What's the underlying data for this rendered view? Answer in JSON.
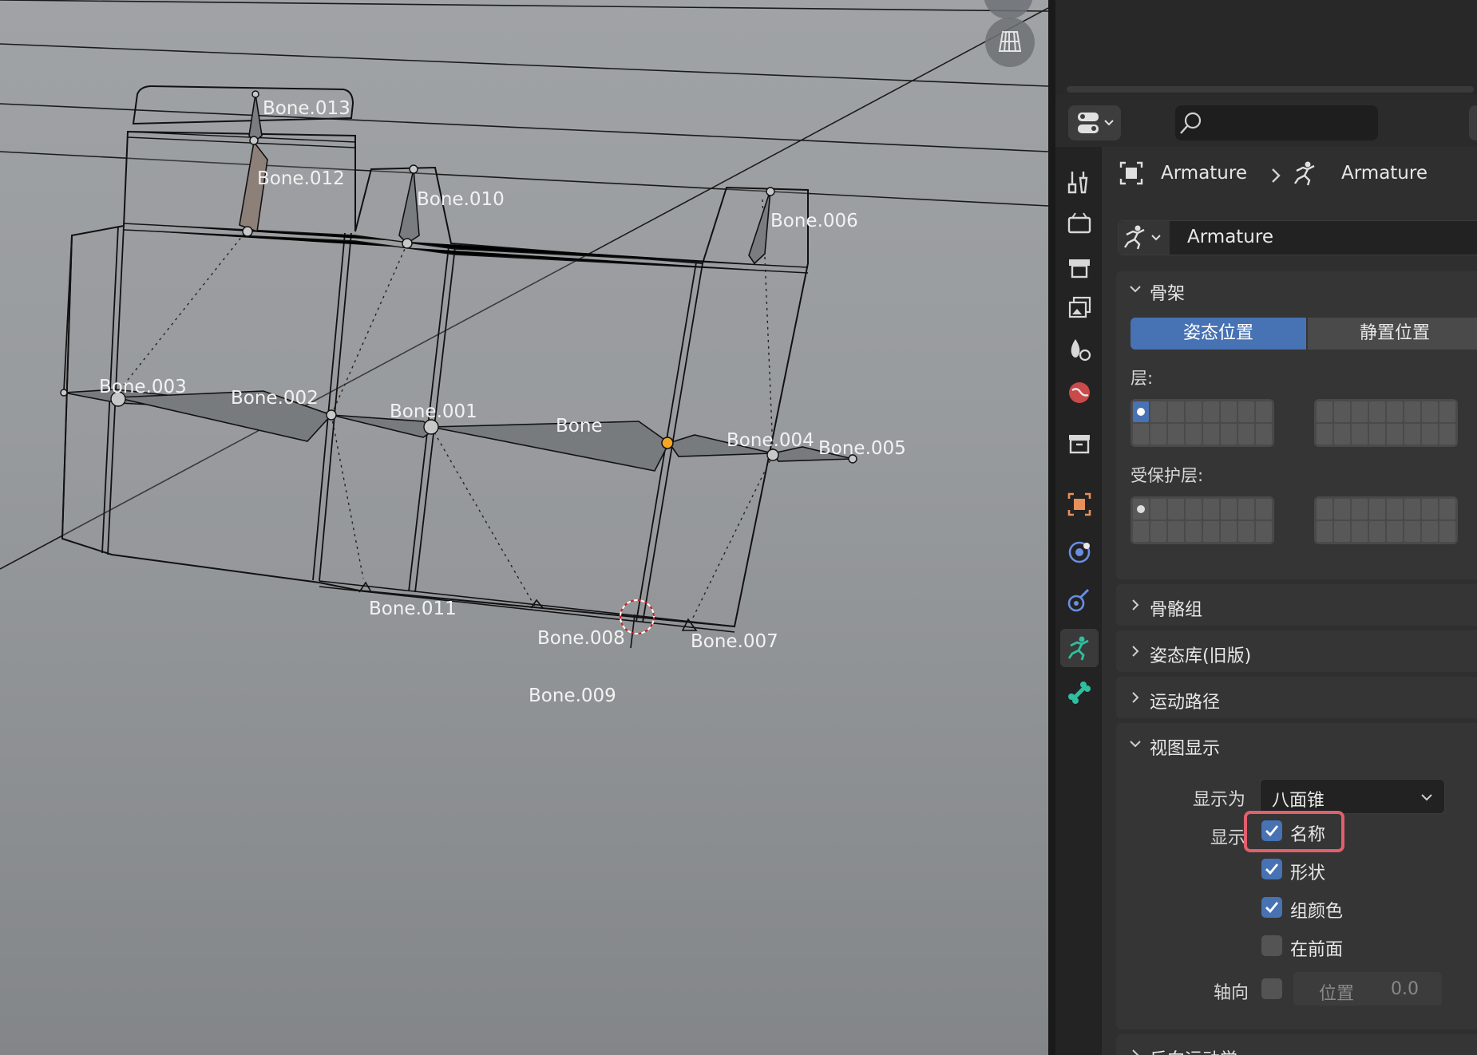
{
  "viewport": {
    "bone_labels": [
      "Bone.013",
      "Bone.012",
      "Bone.010",
      "Bone.006",
      "Bone.003",
      "Bone.002",
      "Bone.001",
      "Bone",
      "Bone.004",
      "Bone.005",
      "Bone.011",
      "Bone.008",
      "Bone.007",
      "Bone.009"
    ]
  },
  "properties": {
    "breadcrumb": {
      "object": "Armature",
      "data": "Armature"
    },
    "datablock_name": "Armature",
    "skeleton": {
      "title": "骨架",
      "pose_position": "姿态位置",
      "rest_position": "静置位置",
      "layers_label": "层:",
      "protected_layers_label": "受保护层:"
    },
    "collapsed_sections": [
      "骨骼组",
      "姿态库(旧版)",
      "运动路径"
    ],
    "viewport_display": {
      "title": "视图显示",
      "display_as_label": "显示为",
      "display_as_value": "八面锥",
      "show_label": "显示",
      "names_label": "名称",
      "names_checked": true,
      "shapes_label": "形状",
      "shapes_checked": true,
      "group_colors_label": "组颜色",
      "group_colors_checked": true,
      "in_front_label": "在前面",
      "in_front_checked": false,
      "axes_label": "轴向",
      "axes_checked": false,
      "position_label": "位置",
      "position_value": "0.0"
    },
    "next_section": "反向运动学"
  },
  "colors": {
    "accent": "#4772b3",
    "highlight_box": "#e0606c",
    "active_tab": "#2dc0a0",
    "active_joint": "#f5a623"
  }
}
